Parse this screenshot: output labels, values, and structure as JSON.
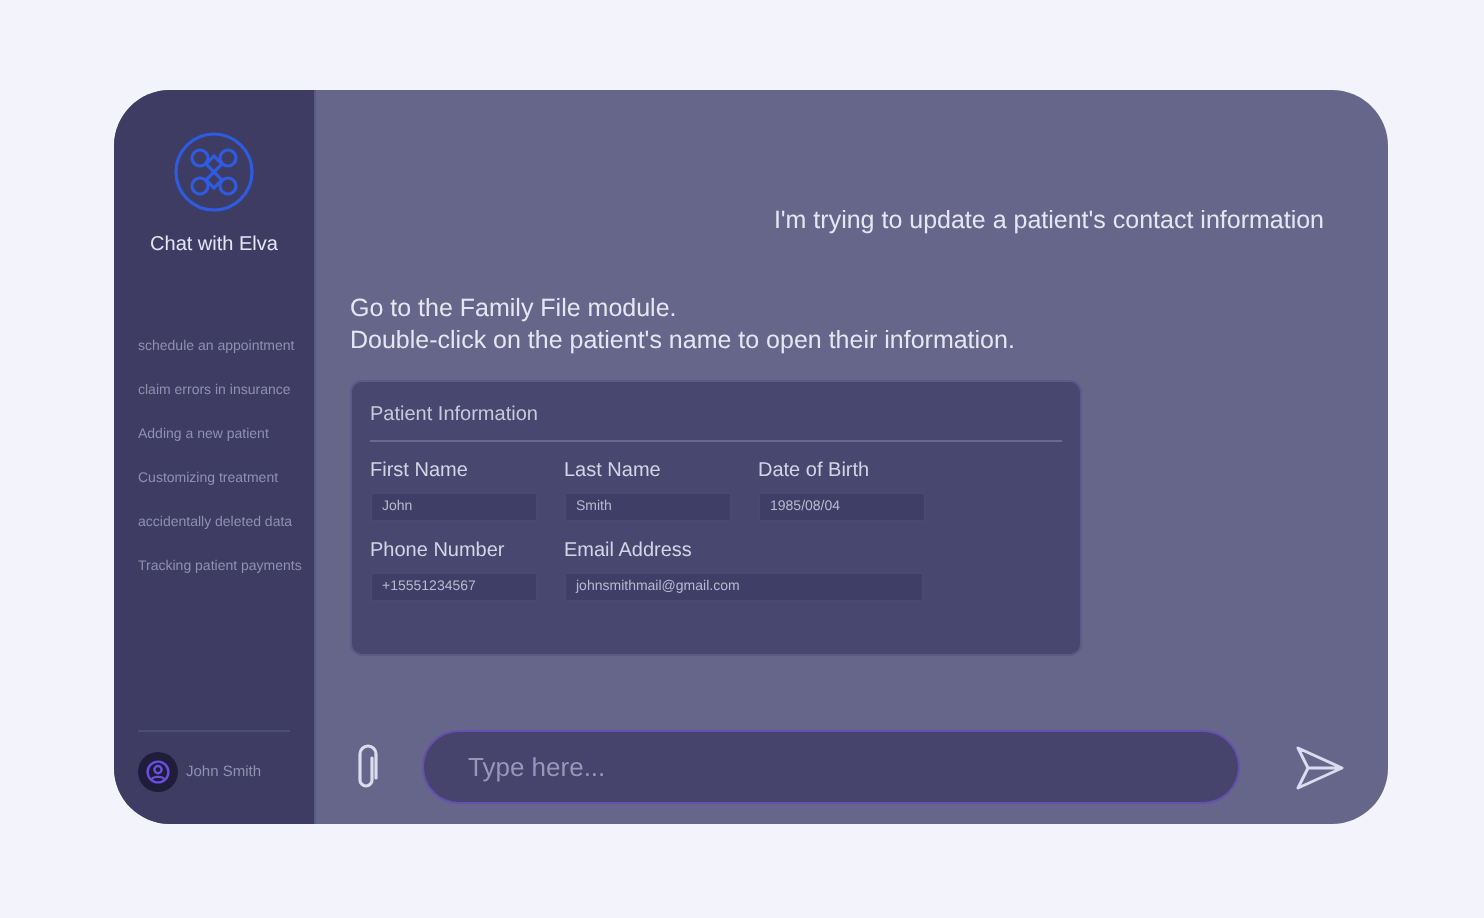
{
  "sidebar": {
    "title": "Chat with Elva",
    "items": [
      "schedule an appointment",
      "claim errors in insurance",
      "Adding a new patient",
      "Customizing treatment",
      "accidentally deleted data",
      "Tracking patient payments"
    ],
    "user": "John Smith"
  },
  "messages": [
    {
      "kind": "user",
      "lines": [
        "I'm trying to update a patient's contact information"
      ]
    },
    {
      "kind": "bot",
      "lines": [
        "Go to the Family File module.",
        "Double-click on the patient's name to open their information."
      ]
    }
  ],
  "card": {
    "title": "Patient Information",
    "rows": [
      [
        {
          "kind": "short",
          "label": "First Name",
          "value": "John"
        },
        {
          "kind": "short",
          "label": "Last Name",
          "value": "Smith"
        },
        {
          "kind": "short",
          "label": "Date of Birth",
          "value": "1985/08/04"
        }
      ],
      [
        {
          "kind": "short",
          "label": "Phone Number",
          "value": "+15551234567"
        },
        {
          "kind": "wide",
          "label": "Email Address",
          "value": "johnsmithmail@gmail.com"
        }
      ]
    ]
  },
  "composer": {
    "placeholder": "Type here..."
  }
}
